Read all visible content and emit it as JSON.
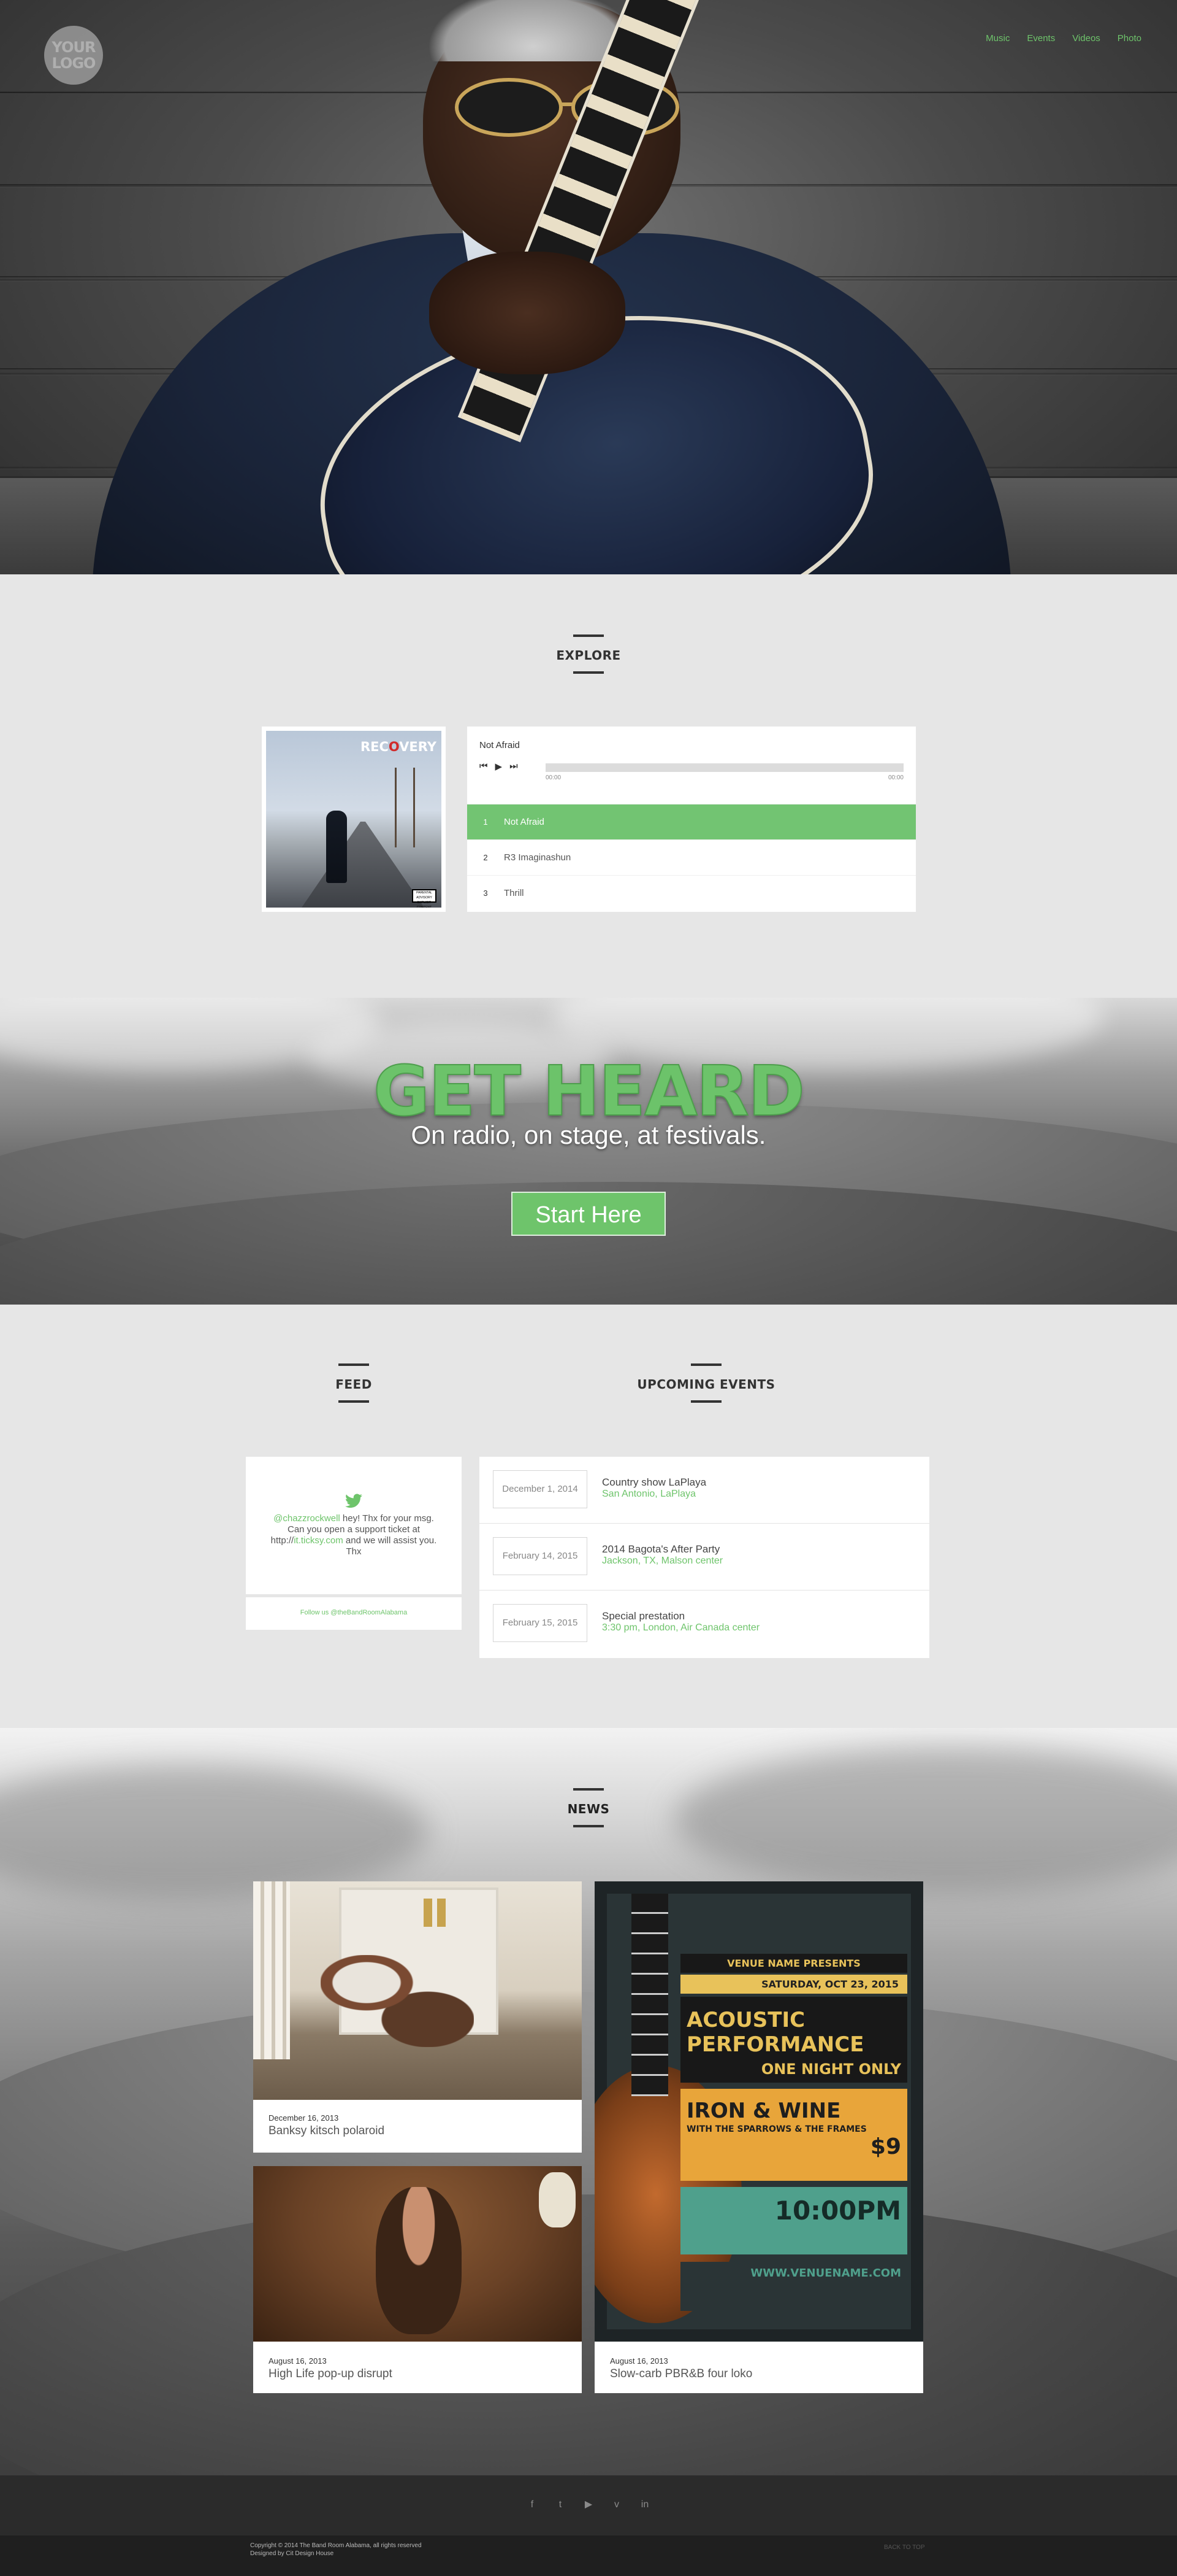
{
  "header": {
    "logo_text": "YOUR LOGO",
    "nav": [
      "Music",
      "Events",
      "Videos",
      "Photo"
    ]
  },
  "explore": {
    "title": "EXPLORE",
    "album": {
      "cover_title_pre": "REC",
      "cover_title_mid": "O",
      "cover_title_post": "VERY",
      "advisory": "PARENTAL ADVISORY EXPLICIT CONTENT"
    },
    "now_playing": "Not Afraid",
    "time_start": "00:00",
    "time_end": "00:00",
    "tracks": [
      {
        "num": "1",
        "title": "Not Afraid",
        "active": true
      },
      {
        "num": "2",
        "title": "R3 Imaginashun",
        "active": false
      },
      {
        "num": "3",
        "title": "Thrill",
        "active": false
      }
    ]
  },
  "banner": {
    "headline": "GET HEARD",
    "subline": "On radio, on stage, at festivals.",
    "cta": "Start Here"
  },
  "feed": {
    "title": "FEED",
    "tweet_user": "@chazzrockwell",
    "tweet_text_1": " hey! Thx for your msg. Can you open a support ticket at http://",
    "tweet_link": "it.ticksy.com",
    "tweet_text_2": " and we will assist you. Thx",
    "follow": "Follow us @theBandRoomAlabama"
  },
  "events": {
    "title": "UPCOMING EVENTS",
    "items": [
      {
        "date": "December 1, 2014",
        "title": "Country show LaPlaya",
        "location": "San Antonio, LaPlaya"
      },
      {
        "date": "February 14, 2015",
        "title": "2014 Bagota's After Party",
        "location": "Jackson, TX, Malson center"
      },
      {
        "date": "February 15, 2015",
        "title": "Special prestation",
        "location": "3:30 pm, London, Air Canada center"
      }
    ]
  },
  "news": {
    "title": "NEWS",
    "items": [
      {
        "date": "December 16, 2013",
        "title": "Banksy kitsch polaroid"
      },
      {
        "date": "August 16, 2013",
        "title": "High Life pop-up disrupt"
      },
      {
        "date": "August 16, 2013",
        "title": "Slow-carb PBR&B four loko"
      }
    ],
    "poster": {
      "l1": "VENUE NAME PRESENTS",
      "l2": "SATURDAY, OCT 23, 2015",
      "l3": "ACOUSTIC PERFORMANCE",
      "l3b": "ONE NIGHT ONLY",
      "l4": "IRON & WINE",
      "l4b": "WITH THE SPARROWS & THE FRAMES",
      "l4c": "$9",
      "l5": "10:00PM",
      "l6": "WWW.VENUENAME.COM"
    }
  },
  "footer": {
    "social_icons": [
      "facebook-icon",
      "twitter-icon",
      "youtube-icon",
      "vimeo-icon",
      "linkedin-icon"
    ],
    "social_glyphs": [
      "f",
      "t",
      "▶",
      "v",
      "in"
    ],
    "copy_1": "Copyright © 2014 The Band Room Alabama, all rights reserved",
    "copy_2": "Designed by Cit Design House",
    "back_to_top": "BACK TO TOP"
  }
}
